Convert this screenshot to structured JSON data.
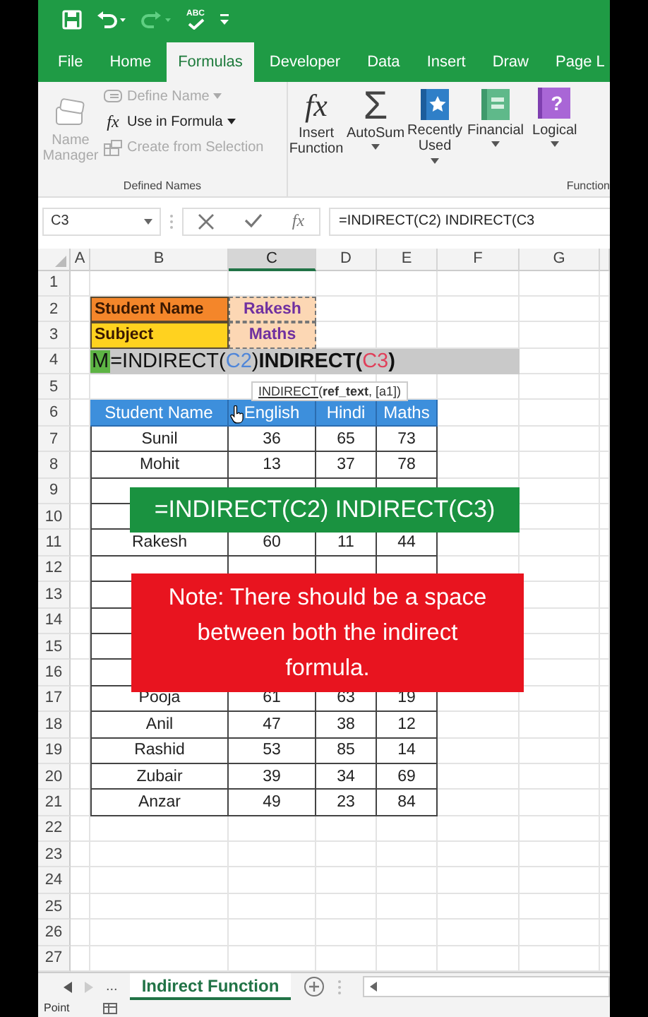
{
  "quick_access": [
    {
      "kind": "save",
      "disabled": false
    },
    {
      "kind": "undo",
      "disabled": false
    },
    {
      "kind": "redo",
      "disabled": true
    },
    {
      "kind": "spelling",
      "label": "ABC",
      "disabled": false
    },
    {
      "kind": "customize",
      "disabled": false
    }
  ],
  "tabs": [
    {
      "label": "File",
      "selected": false
    },
    {
      "label": "Home",
      "selected": false
    },
    {
      "label": "Formulas",
      "selected": true
    },
    {
      "label": "Developer",
      "selected": false
    },
    {
      "label": "Data",
      "selected": false
    },
    {
      "label": "Insert",
      "selected": false
    },
    {
      "label": "Draw",
      "selected": false
    },
    {
      "label": "Page L",
      "selected": false
    }
  ],
  "defined_names": {
    "label": "Defined Names",
    "name_manager": {
      "label": "Name Manager",
      "disabled": true
    },
    "items": [
      {
        "kind": "define",
        "label": "Define Name",
        "disabled": true,
        "dropdown": true
      },
      {
        "kind": "use",
        "label": "Use in Formula",
        "icon_text": "fx",
        "disabled": false,
        "dropdown": true
      },
      {
        "kind": "create",
        "label": "Create from Selection",
        "disabled": true,
        "dropdown": false
      }
    ]
  },
  "function_library": {
    "label": "Function",
    "buttons": [
      {
        "kind": "insert_function",
        "label": "Insert Function",
        "icon_text": "fx",
        "dropdown": false
      },
      {
        "kind": "autosum",
        "label": "AutoSum",
        "icon_text": "Σ",
        "dropdown": true
      },
      {
        "kind": "recent",
        "label": "Recently Used",
        "dropdown": true
      },
      {
        "kind": "financial",
        "label": "Financial",
        "dropdown": true
      },
      {
        "kind": "logical",
        "label": "Logical",
        "icon_text": "?",
        "dropdown": true
      }
    ]
  },
  "formula_bar": {
    "name_box": "C3",
    "icon_text": "fx",
    "formula": "=INDIRECT(C2) INDIRECT(C3"
  },
  "columns": [
    {
      "label": "A",
      "selected": false
    },
    {
      "label": "B",
      "selected": false
    },
    {
      "label": "C",
      "selected": true
    },
    {
      "label": "D",
      "selected": false
    },
    {
      "label": "E",
      "selected": false
    },
    {
      "label": "F",
      "selected": false
    },
    {
      "label": "G",
      "selected": false
    }
  ],
  "rows": [
    {
      "number": "1",
      "kind": "blank"
    },
    {
      "number": "2",
      "kind": "label",
      "color": "#f4862a",
      "b": "Student Name",
      "c": "Rakesh"
    },
    {
      "number": "3",
      "kind": "label",
      "color": "#ffd21f",
      "b": "Subject",
      "c": "Maths"
    },
    {
      "number": "4",
      "kind": "editing",
      "parts": [
        {
          "text": "M",
          "kind": "cursor"
        },
        {
          "text": "=INDIRECT(",
          "kind": "plain"
        },
        {
          "text": "C2",
          "kind": "ref",
          "color": "#4f86d9"
        },
        {
          "text": ") ",
          "kind": "plain"
        },
        {
          "text": "INDIRECT(",
          "kind": "bold"
        },
        {
          "text": "C3",
          "kind": "ref",
          "color": "#e0405a"
        },
        {
          "text": ")",
          "kind": "bold"
        }
      ]
    },
    {
      "number": "5",
      "kind": "blank"
    },
    {
      "number": "6",
      "kind": "header",
      "b": "Student Name",
      "c": "English",
      "d": "Hindi",
      "e": "Maths"
    },
    {
      "number": "7",
      "kind": "data",
      "b": "Sunil",
      "c": "36",
      "d": "65",
      "e": "73"
    },
    {
      "number": "8",
      "kind": "data",
      "b": "Mohit",
      "c": "13",
      "d": "37",
      "e": "78"
    },
    {
      "number": "9",
      "kind": "data"
    },
    {
      "number": "10",
      "kind": "data"
    },
    {
      "number": "11",
      "kind": "data",
      "b": "Rakesh",
      "c": "60",
      "d": "11",
      "e": "44"
    },
    {
      "number": "12",
      "kind": "data"
    },
    {
      "number": "13",
      "kind": "data"
    },
    {
      "number": "14",
      "kind": "data"
    },
    {
      "number": "15",
      "kind": "data"
    },
    {
      "number": "16",
      "kind": "data"
    },
    {
      "number": "17",
      "kind": "data",
      "b": "Pooja",
      "c": "61",
      "d": "63",
      "e": "19"
    },
    {
      "number": "18",
      "kind": "data",
      "b": "Anil",
      "c": "47",
      "d": "38",
      "e": "12"
    },
    {
      "number": "19",
      "kind": "data",
      "b": "Rashid",
      "c": "53",
      "d": "85",
      "e": "14"
    },
    {
      "number": "20",
      "kind": "data",
      "b": "Zubair",
      "c": "39",
      "d": "34",
      "e": "69"
    },
    {
      "number": "21",
      "kind": "data",
      "b": "Anzar",
      "c": "49",
      "d": "23",
      "e": "84"
    },
    {
      "number": "22",
      "kind": "blank"
    },
    {
      "number": "23",
      "kind": "blank"
    },
    {
      "number": "24",
      "kind": "blank"
    },
    {
      "number": "25",
      "kind": "blank"
    },
    {
      "number": "26",
      "kind": "blank"
    },
    {
      "number": "27",
      "kind": "blank"
    }
  ],
  "tooltip": {
    "name": "INDIRECT",
    "args": "(**ref_text**, [a1])"
  },
  "banner": {
    "text": "=INDIRECT(C2) INDIRECT(C3)"
  },
  "note": {
    "text": "Note: There should be a space between both the indirect formula."
  },
  "sheet_tabs": {
    "more": "...",
    "tabs": [
      {
        "label": "Indirect Function",
        "selected": true
      }
    ]
  },
  "status_bar": {
    "mode": "Point"
  }
}
